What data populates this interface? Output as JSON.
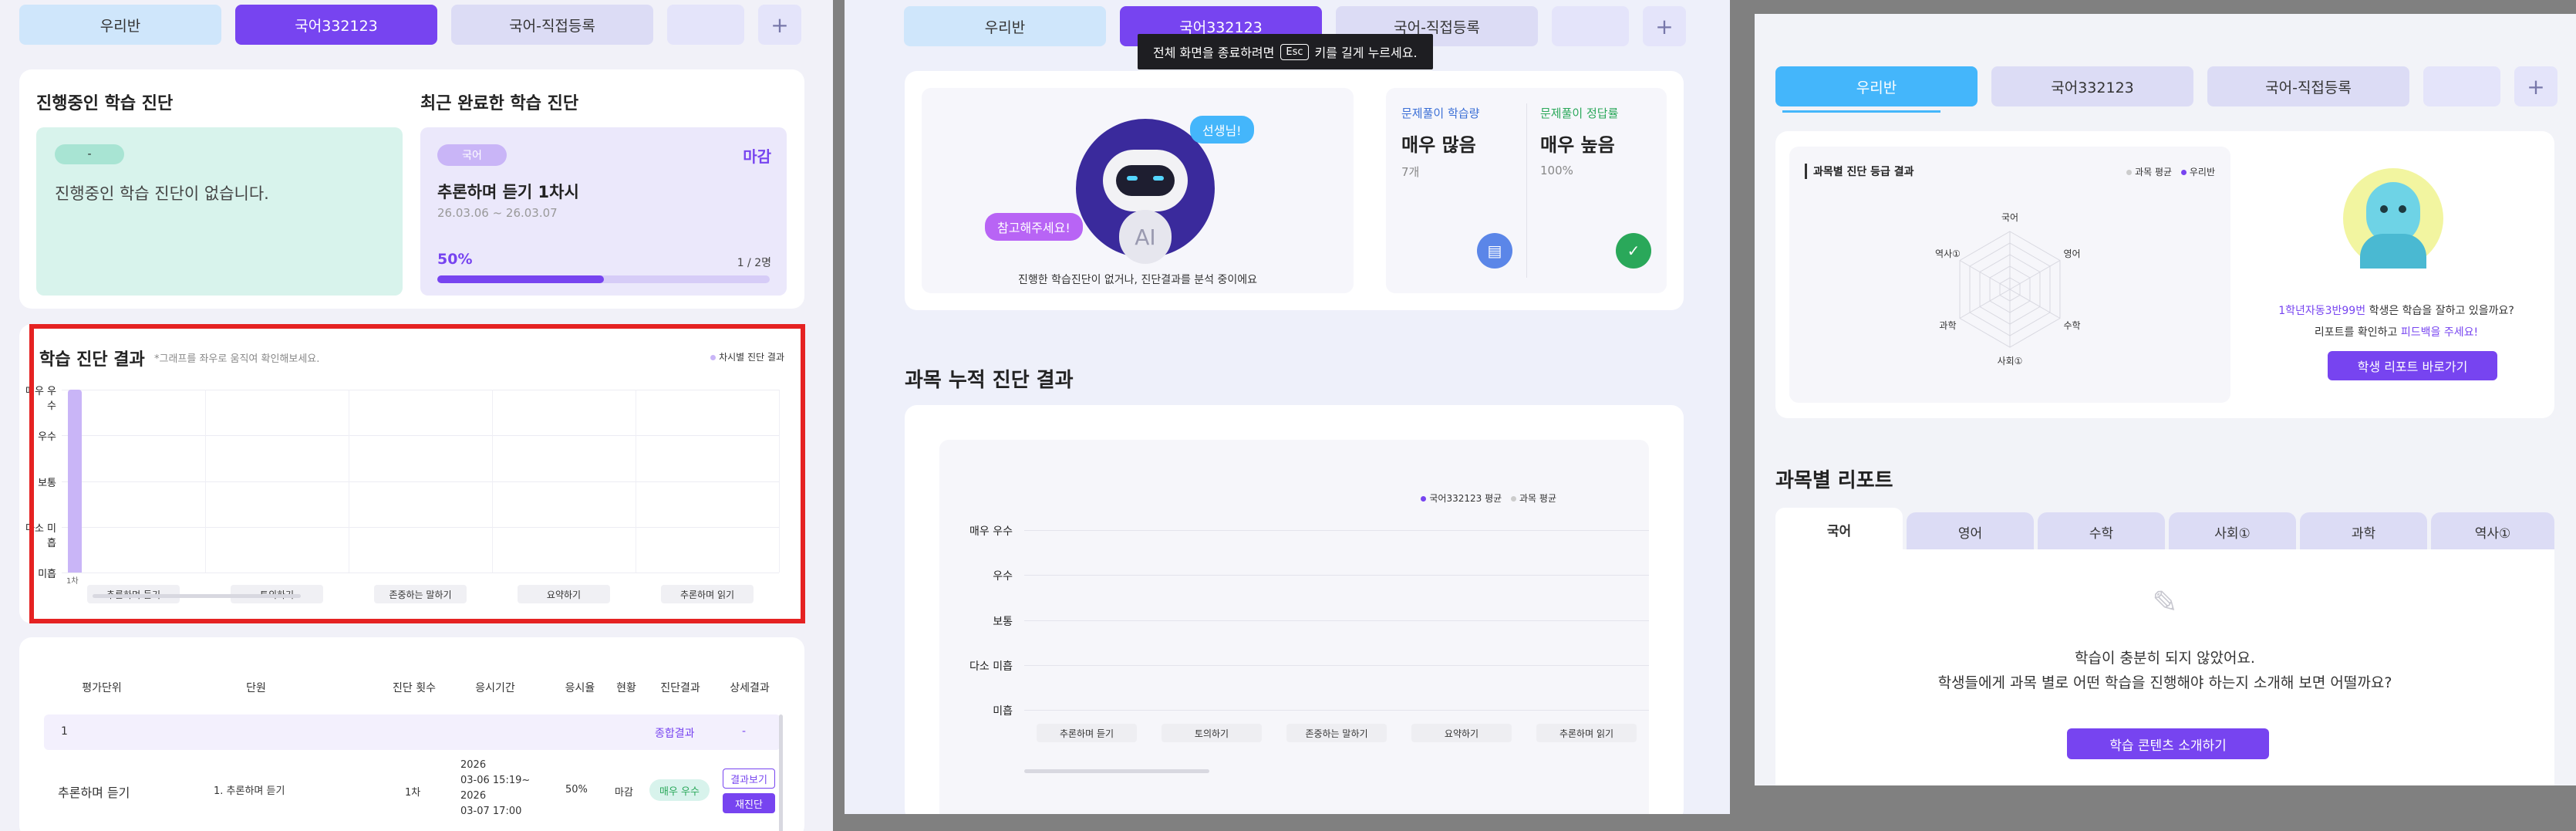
{
  "class_tabs": [
    "우리반",
    "국어332123",
    "국어-직접등록"
  ],
  "add_tab": "+",
  "fullscreen_toast": {
    "pre": "전체 화면을 종료하려면",
    "key": "Esc",
    "post": "키를 길게 누르세요."
  },
  "in_progress": {
    "title": "진행중인 학습 진단",
    "chip": "-",
    "empty_text": "진행중인 학습 진단이 없습니다."
  },
  "recent": {
    "title": "최근 완료한 학습 진단",
    "subject": "국어",
    "status": "마감",
    "name": "추론하며 듣기 1차시",
    "period": "26.03.06 ~ 26.03.07",
    "progress_label": "50%",
    "progress": 0.5,
    "count": "1 / 2명"
  },
  "diagnosis_chart": {
    "title": "학습 진단 결과",
    "hint": "*그래프를 좌우로 움직여 확인해보세요.",
    "legend": "차시별 진단 결과",
    "bar_label": "1차"
  },
  "chart_data": [
    {
      "type": "bar",
      "title": "학습 진단 결과",
      "y_categories": [
        "매우 우수",
        "우수",
        "보통",
        "다소 미흡",
        "미흡"
      ],
      "categories": [
        "추론하며 듣기",
        "토의하기",
        "존중하는 말하기",
        "요약하기",
        "추론하며 읽기"
      ],
      "series": [
        {
          "name": "차시별 진단 결과",
          "values": [
            "매우 우수",
            null,
            null,
            null,
            null
          ]
        }
      ],
      "grid": true,
      "legend_position": "top-right"
    },
    {
      "type": "line",
      "title": "과목 누적 진단 결과",
      "y_categories": [
        "매우 우수",
        "우수",
        "보통",
        "다소 미흡",
        "미흡"
      ],
      "categories": [
        "추론하며 듣기",
        "토의하기",
        "존중하는 말하기",
        "요약하기",
        "추론하며 읽기"
      ],
      "series": [
        {
          "name": "국어332123 평균",
          "values": [
            null,
            null,
            null,
            null,
            null
          ]
        },
        {
          "name": "과목 평균",
          "values": [
            null,
            null,
            null,
            null,
            null
          ]
        }
      ],
      "grid": true,
      "legend_position": "top-right"
    },
    {
      "type": "radar",
      "title": "과목별 진단 등급 결과",
      "categories": [
        "국어",
        "영어",
        "수학",
        "사회①",
        "과학",
        "역사①"
      ],
      "series": [
        {
          "name": "과목 평균",
          "values": [
            null,
            null,
            null,
            null,
            null,
            null
          ]
        },
        {
          "name": "우리반",
          "values": [
            null,
            null,
            null,
            null,
            null,
            null
          ]
        }
      ],
      "legend_position": "top-right"
    }
  ],
  "result_table": {
    "headers": [
      "평가단위",
      "단원",
      "진단 횟수",
      "응시기간",
      "응시율",
      "현황",
      "진단결과",
      "상세결과"
    ],
    "group_row": {
      "index": "1",
      "summary": "종합결과",
      "dash": "-"
    },
    "row": {
      "unit": "추론하며 듣기",
      "chapter": "1. 추론하며 듣기",
      "times": "1차",
      "period_lines": [
        "2026",
        "03-06 15:19~",
        "2026",
        "03-07 17:00"
      ],
      "rate": "50%",
      "status": "마감",
      "result": "매우 우수",
      "view_btn": "결과보기",
      "retest_btn": "재진단"
    }
  },
  "ai_card": {
    "bubble_top": "선생님!",
    "bubble_left": "참고해주세요!",
    "robot_label": "AI",
    "caption": "진행한 학습진단이 없거나, 진단결과를 분석 중이에요"
  },
  "stats": [
    {
      "label": "문제풀이 학습량",
      "value": "매우 많음",
      "sub": "7개",
      "color": "#3b6fd6"
    },
    {
      "label": "문제풀이 정답률",
      "value": "매우 높음",
      "sub": "100%",
      "color": "#2aa85a"
    }
  ],
  "cumulative": {
    "title": "과목 누적 진단 결과"
  },
  "grade_card": {
    "title": "과목별 진단 등급 결과",
    "student_line": {
      "name": "1학년자동3반99번",
      "rest": "학생은 학습을 잘하고 있을까요?"
    },
    "feedback_line": {
      "pre": "리포트를 확인하고",
      "link": "피드백을 주세요!"
    },
    "report_btn": "학생 리포트 바로가기"
  },
  "subject_report": {
    "title": "과목별 리포트",
    "tabs": [
      "국어",
      "영어",
      "수학",
      "사회①",
      "과학",
      "역사①"
    ],
    "empty_line1": "학습이 충분히 되지 않았어요.",
    "empty_line2": "학생들에게 과목 별로 어떤 학습을 진행해야 하는지 소개해 보면 어떨까요?",
    "button": "학습 콘텐츠 소개하기"
  },
  "colors": {
    "accent": "#7744f0",
    "blue_tab": "#44b6fb",
    "highlight_box": "#e52222",
    "mint": "#d8f3ec",
    "lavender": "#ebe8fb"
  }
}
